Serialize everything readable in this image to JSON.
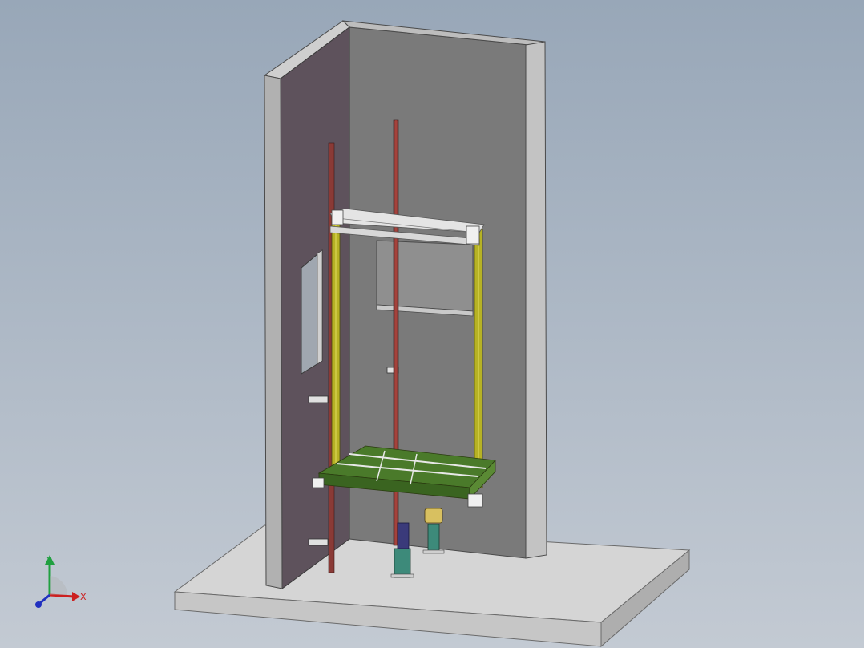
{
  "viewport": {
    "background_top": "#98a7b8",
    "background_bottom": "#c3cad3"
  },
  "model": {
    "colors": {
      "base_top": "#d5d5d5",
      "base_front": "#cacaca",
      "base_side": "#b3b3b3",
      "wall_left_face": "#5e525c",
      "wall_left_edge": "#b1b1b1",
      "wall_back": "#7a7a7a",
      "wall_back_top": "#bdbdbd",
      "wall_right_edge": "#c3c3c3",
      "guide_rail": "#8a3a36",
      "car_frame_yellow": "#b6b224",
      "car_floor_green": "#4a7a2a",
      "header_beam": "#e4e4e4",
      "buffer_blue": "#3a3a7a",
      "buffer_teal": "#3d8a7a",
      "buffer_yellow": "#d8c060"
    }
  },
  "triad": {
    "x_label": "X",
    "y_label": "Y",
    "colors": {
      "x": "#cc2020",
      "y": "#20a040",
      "z": "#2030c0"
    }
  }
}
